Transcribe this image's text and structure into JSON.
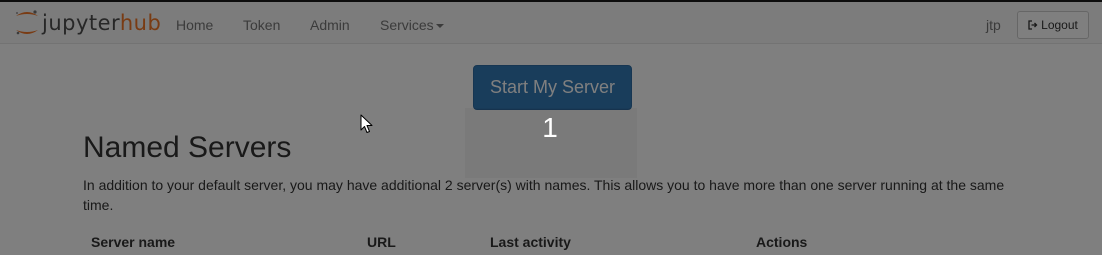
{
  "navbar": {
    "logo": {
      "prefix": "jupyter",
      "suffix": "hub"
    },
    "links": [
      {
        "id": "home",
        "label": "Home"
      },
      {
        "id": "token",
        "label": "Token"
      },
      {
        "id": "admin",
        "label": "Admin"
      },
      {
        "id": "services",
        "label": "Services"
      }
    ],
    "user": "jtp",
    "logout_label": "Logout"
  },
  "main": {
    "start_button_label": "Start My Server",
    "step_number": "1",
    "named_servers": {
      "title": "Named Servers",
      "description": "In addition to your default server, you may have additional 2 server(s) with names. This allows you to have more than one server running at the same time.",
      "columns": [
        "Server name",
        "URL",
        "Last activity",
        "Actions"
      ]
    }
  },
  "colors": {
    "brand_orange": "#f37726",
    "primary_blue": "#337ab7",
    "overlay": "rgba(0,0,0,0.5)"
  },
  "icons": {
    "logo": "jupyter-logo-icon",
    "logout": "sign-out-icon",
    "services_caret": "caret-down-icon",
    "cursor": "mouse-pointer-icon"
  }
}
